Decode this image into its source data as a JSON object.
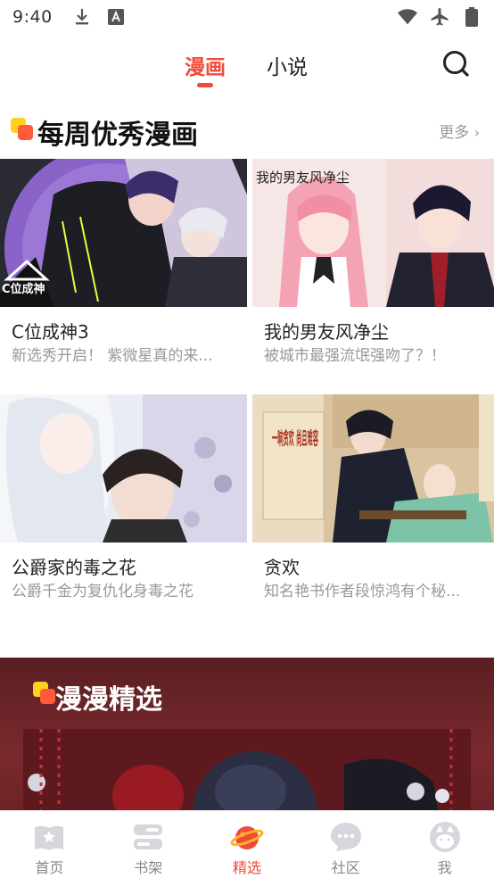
{
  "status_bar": {
    "time": "9:40",
    "left_icons": [
      "download-icon",
      "font-icon"
    ],
    "right_icons": [
      "wifi-icon",
      "airplane-icon",
      "battery-icon"
    ]
  },
  "top_tabs": {
    "items": [
      {
        "label": "漫画",
        "active": true
      },
      {
        "label": "小说",
        "active": false
      }
    ],
    "accent_color": "#f04a3a",
    "search_icon": "search-icon"
  },
  "weekly": {
    "title": "每周优秀漫画",
    "more_label": "更多",
    "cards": [
      {
        "title": "C位成神3",
        "desc": "新选秀开启！ 紫微星真的来...",
        "cover_text": "C位成神"
      },
      {
        "title": "我的男友风净尘",
        "desc": "被城市最强流氓强吻了？！",
        "cover_text": "我的男友风净尘"
      },
      {
        "title": "公爵家的毒之花",
        "desc": "公爵千金为复仇化身毒之花",
        "cover_text": ""
      },
      {
        "title": "贪欢",
        "desc": "知名艳书作者段惊鸿有个秘...",
        "cover_text": "一晌贪欢 尚且难容"
      }
    ]
  },
  "featured": {
    "title": "漫漫精选"
  },
  "bottom_nav": {
    "items": [
      {
        "label": "首页",
        "icon": "book-star-icon",
        "active": false
      },
      {
        "label": "书架",
        "icon": "bookshelf-icon",
        "active": false
      },
      {
        "label": "精选",
        "icon": "planet-icon",
        "active": true
      },
      {
        "label": "社区",
        "icon": "chat-bubble-icon",
        "active": false
      },
      {
        "label": "我",
        "icon": "cat-face-icon",
        "active": false
      }
    ]
  }
}
